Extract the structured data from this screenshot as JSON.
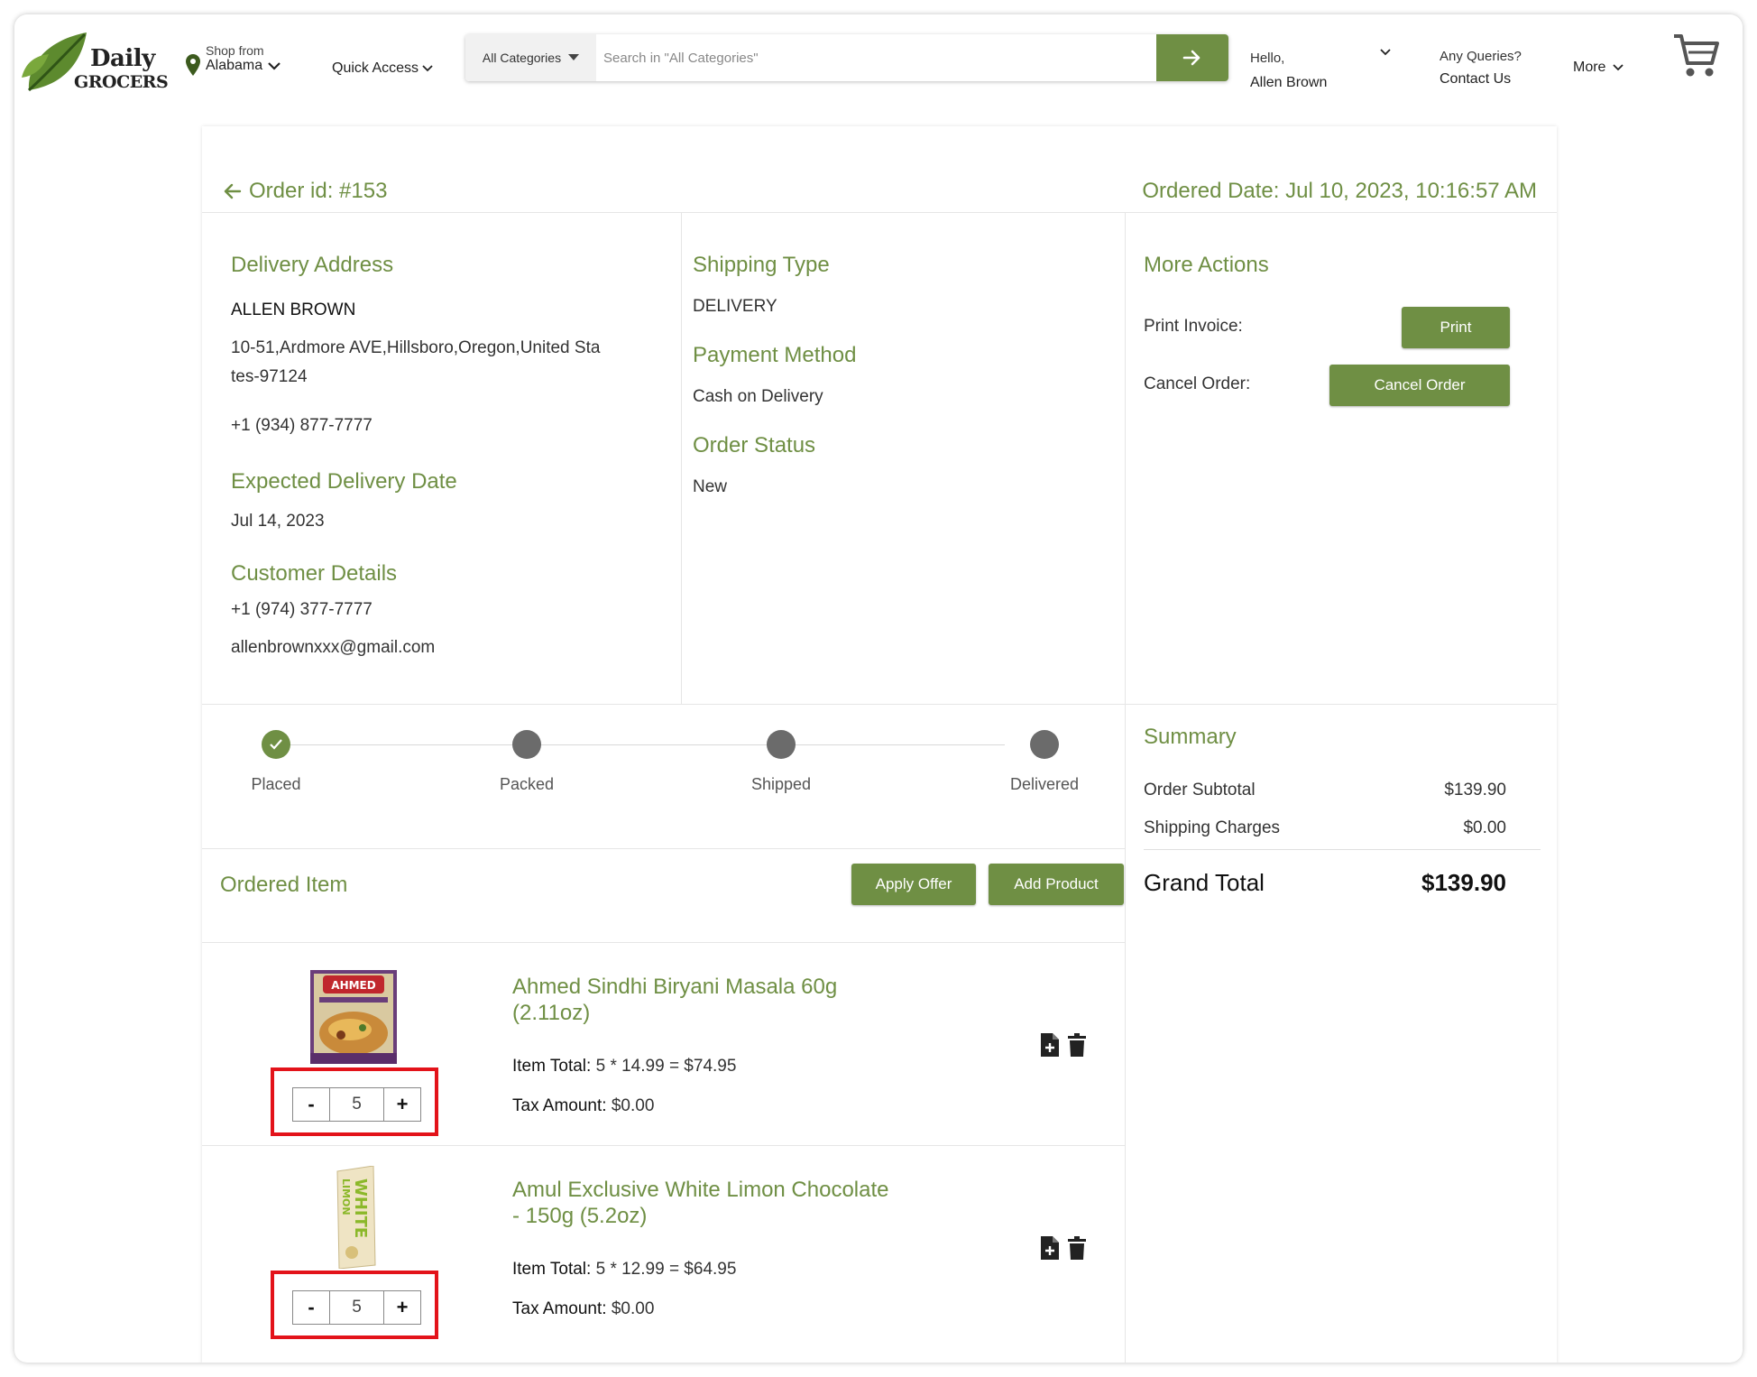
{
  "brand": {
    "line1": "Daily",
    "line2": "GROCERS",
    "leaf_color": "#5d8a2e"
  },
  "header": {
    "shop_from_label": "Shop from",
    "shop_from_value": "Alabama",
    "quick_access": "Quick Access",
    "search_category": "All Categories",
    "search_placeholder": "Search in \"All Categories\"",
    "hello": "Hello,",
    "user_name": "Allen Brown",
    "queries": "Any Queries?",
    "contact": "Contact Us",
    "more": "More"
  },
  "order": {
    "id_label": "Order id: #153",
    "date_label": "Ordered Date: Jul 10, 2023, 10:16:57 AM"
  },
  "delivery": {
    "title": "Delivery Address",
    "name": "ALLEN BROWN",
    "address_line1": "10-51,Ardmore AVE,Hillsboro,Oregon,United Sta",
    "address_line2": "tes-97124",
    "phone": "+1 (934) 877-7777",
    "expected_title": "Expected Delivery Date",
    "expected_date": "Jul 14, 2023",
    "customer_title": "Customer Details",
    "customer_phone": "+1 (974) 377-7777",
    "customer_email": "allenbrownxxx@gmail.com"
  },
  "shipping": {
    "type_title": "Shipping Type",
    "type_value": "DELIVERY",
    "payment_title": "Payment Method",
    "payment_value": "Cash on Delivery",
    "status_title": "Order Status",
    "status_value": "New"
  },
  "actions": {
    "title": "More Actions",
    "print_label": "Print Invoice:",
    "print_button": "Print",
    "cancel_label": "Cancel Order:",
    "cancel_button": "Cancel Order"
  },
  "tracker": {
    "steps": [
      {
        "label": "Placed",
        "done": true
      },
      {
        "label": "Packed",
        "done": false
      },
      {
        "label": "Shipped",
        "done": false
      },
      {
        "label": "Delivered",
        "done": false
      }
    ]
  },
  "ordered": {
    "title": "Ordered Item",
    "apply_offer": "Apply Offer",
    "add_product": "Add Product",
    "items": [
      {
        "name": "Ahmed Sindhi Biryani Masala 60g (2.11oz)",
        "item_total_label": "Item Total:",
        "item_total_value": "5 * 14.99 = $74.95",
        "tax_label": "Tax Amount:",
        "tax_value": "$0.00",
        "qty": "5",
        "minus": "-",
        "plus": "+",
        "img_text": "AHMED"
      },
      {
        "name": "Amul Exclusive White Limon Chocolate - 150g (5.2oz)",
        "item_total_label": "Item Total:",
        "item_total_value": "5 * 12.99 = $64.95",
        "tax_label": "Tax Amount:",
        "tax_value": "$0.00",
        "qty": "5",
        "minus": "-",
        "plus": "+",
        "img_text1": "WHITE",
        "img_text2": "LIMON"
      }
    ]
  },
  "summary": {
    "title": "Summary",
    "subtotal_label": "Order Subtotal",
    "subtotal_value": "$139.90",
    "shipping_label": "Shipping Charges",
    "shipping_value": "$0.00",
    "grand_label": "Grand Total",
    "grand_value": "$139.90"
  },
  "colors": {
    "accent": "#6f8f44",
    "highlight": "#e3131a",
    "pending_dot": "#6b6b6b"
  }
}
